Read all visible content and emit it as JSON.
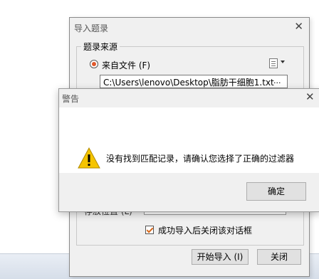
{
  "import_dialog": {
    "title": "导入题录",
    "close_glyph": "✕",
    "group_label": "题录来源",
    "source_radio_label": "来自文件 (F)",
    "source_menu_icon": "list-menu-icon",
    "file_path_value": "C:\\Users\\lenovo\\Desktop\\脂肪干细胞1.txt",
    "browse_label": "...",
    "save_location_label": "存放位置 (L)",
    "close_after_import_label": "成功导入后关闭该对话框",
    "start_import_label": "开始导入 (I)",
    "close_label": "关闭"
  },
  "alert_dialog": {
    "title": "警告",
    "close_glyph": "✕",
    "icon": "warning-icon",
    "message": "没有找到匹配记录，请确认您选择了正确的过滤器",
    "ok_label": "确定",
    "warning_color": "#f5c400"
  }
}
